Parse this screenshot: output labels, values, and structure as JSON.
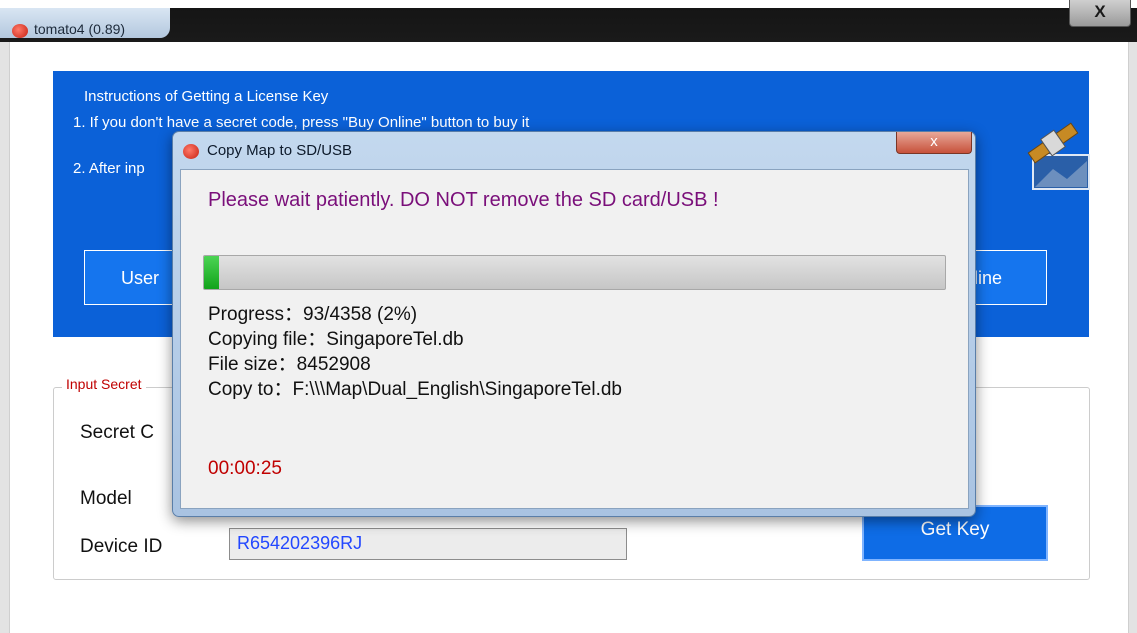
{
  "main_window": {
    "title": "tomato4 (0.89)",
    "close_glyph": "X"
  },
  "instructions": {
    "heading": "Instructions of Getting a License Key",
    "step1": "1. If you don't have a secret code, press \"Buy Online\" button to buy it",
    "step2_partial": "2. After inp",
    "user_button_partial": "User",
    "online_button_partial": "line",
    "satellite_icon": "satellite-icon"
  },
  "secret_section": {
    "legend_partial": "Input Secret",
    "secret_code_label_partial": "Secret C",
    "model_label": "Model",
    "device_id_label": "Device ID",
    "device_id_value": "R654202396RJ",
    "get_key_label": "Get Key"
  },
  "dialog": {
    "title": "Copy Map to SD/USB",
    "close_glyph": "x",
    "warning": "Please wait patiently. DO NOT remove the SD card/USB !",
    "progress_fraction": 0.02,
    "progress_line": "Progress：93/4358  (2%)",
    "copying_line": "Copying file：SingaporeTel.db",
    "filesize_line": "File size：8452908",
    "copyto_line": "Copy to：F:\\\\\\Map\\Dual_English\\SingaporeTel.db",
    "elapsed": "00:00:25"
  },
  "colors": {
    "panel_blue": "#0b61d8",
    "warning_purple": "#7a0f7a",
    "elapsed_red": "#c00000",
    "progress_green": "#12a31b",
    "device_id_blue": "#2247ff"
  }
}
